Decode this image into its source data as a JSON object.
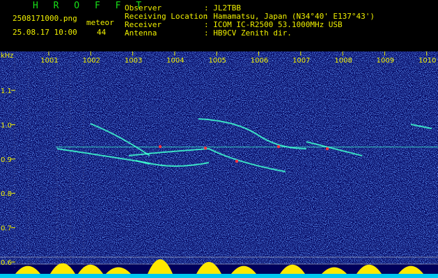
{
  "header": {
    "program_name": "H R O F F T",
    "filename": "2508171000.png",
    "datetime": "25.08.17 10:00",
    "meteor_label": "meteor",
    "meteor_count": "44",
    "info_labels": [
      "Observer",
      "Receiving Location",
      "Receiver",
      "Antenna"
    ],
    "info_values": [
      ": JL2TBB",
      ": Hamamatsu, Japan (N34°40' E137°43')",
      ": ICOM IC-R2500 53.1000MHz USB",
      ": HB9CV Zenith dir."
    ]
  },
  "chart_data": {
    "type": "heatmap",
    "ylabel": "kHz",
    "y_ticks": [
      "1.1",
      "1.0",
      "0.9",
      "0.8",
      "0.7",
      "0.6"
    ],
    "x_ticks": [
      "1001",
      "1002",
      "1003",
      "1004",
      "1005",
      "1006",
      "1007",
      "1008",
      "1009",
      "1010"
    ],
    "ylim": [
      0.58,
      1.2
    ],
    "carrier_khz": 0.935,
    "colors": {
      "background": "#00005a",
      "noise_low": "#1020c8",
      "noise_high": "#2a7aff",
      "trail": "#40ffd0",
      "peak": "#ff3040",
      "amplitude": "#ffe800",
      "baseline": "#00c8f0",
      "tick_text": "#f0f000",
      "grid": "#cfcfcf"
    }
  }
}
